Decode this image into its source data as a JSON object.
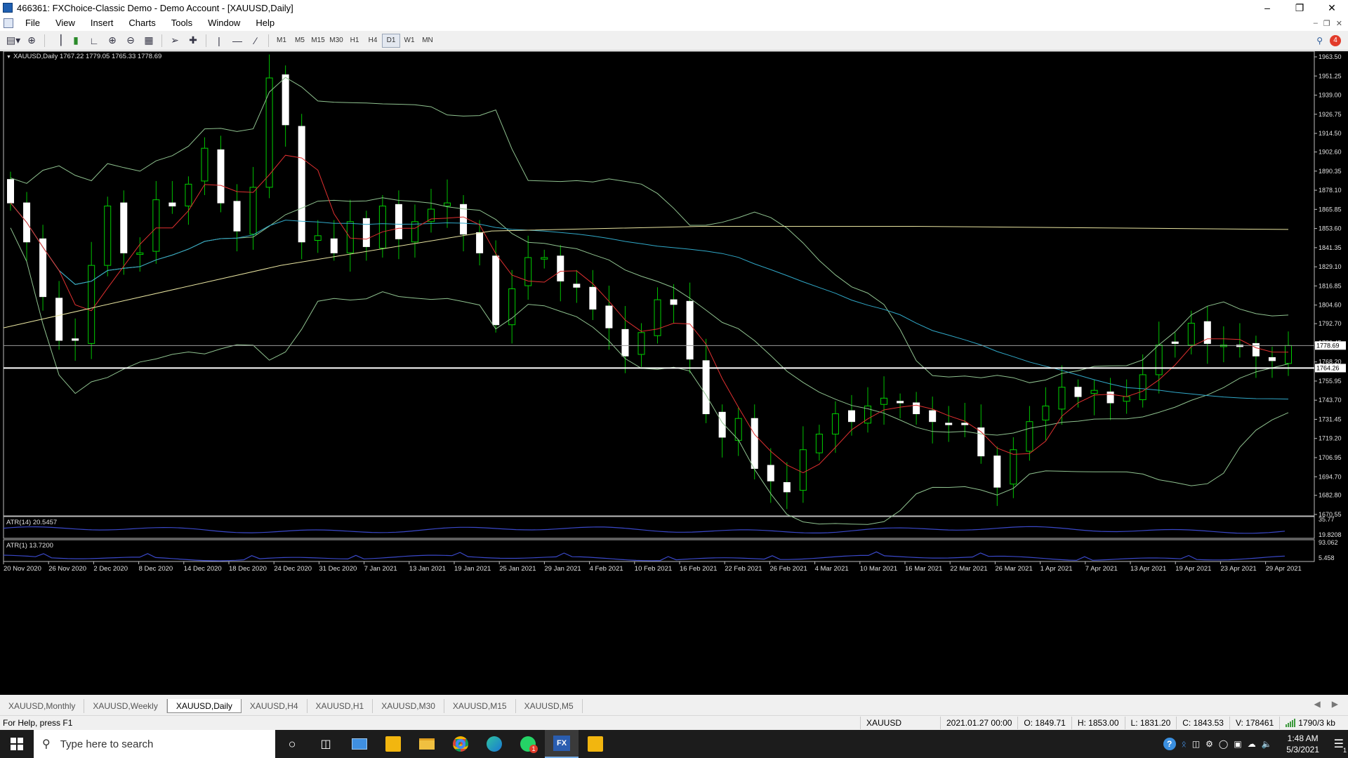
{
  "window": {
    "title": "466361: FXChoice-Classic Demo - Demo Account - [XAUUSD,Daily]",
    "minimize_icon": "minimize-icon",
    "restore_icon": "restore-icon",
    "close_icon": "close-icon"
  },
  "menu": {
    "items": [
      "File",
      "View",
      "Insert",
      "Charts",
      "Tools",
      "Window",
      "Help"
    ]
  },
  "toolbar": {
    "icons": [
      "new-chart-icon",
      "profiles-icon",
      "bar-chart-icon",
      "candlestick-icon",
      "line-chart-icon",
      "zoom-in-icon",
      "zoom-out-icon",
      "tile-windows-icon",
      "cursor-icon",
      "crosshair-icon",
      "vertical-line-icon",
      "horizontal-line-icon",
      "trendline-icon"
    ],
    "timeframes": [
      "M1",
      "M5",
      "M15",
      "M30",
      "H1",
      "H4",
      "D1",
      "W1",
      "MN"
    ],
    "active_timeframe": "D1",
    "notification_count": "4"
  },
  "chart": {
    "header": "XAUUSD,Daily  1767.22 1779.05 1765.33 1778.69",
    "price_ticks": [
      "1963.50",
      "1951.25",
      "1939.00",
      "1926.75",
      "1914.50",
      "1902.60",
      "1890.35",
      "1878.10",
      "1865.85",
      "1853.60",
      "1841.35",
      "1829.10",
      "1816.85",
      "1804.60",
      "1792.70",
      "1780.45",
      "1768.20",
      "1755.95",
      "1743.70",
      "1731.45",
      "1719.20",
      "1706.95",
      "1694.70",
      "1682.80",
      "1670.55"
    ],
    "current_price_label": "1778.69",
    "horizontal_line_label": "1764.26",
    "date_ticks": [
      "20 Nov 2020",
      "26 Nov 2020",
      "2 Dec 2020",
      "8 Dec 2020",
      "14 Dec 2020",
      "18 Dec 2020",
      "24 Dec 2020",
      "31 Dec 2020",
      "7 Jan 2021",
      "13 Jan 2021",
      "19 Jan 2021",
      "25 Jan 2021",
      "29 Jan 2021",
      "4 Feb 2021",
      "10 Feb 2021",
      "16 Feb 2021",
      "22 Feb 2021",
      "26 Feb 2021",
      "4 Mar 2021",
      "10 Mar 2021",
      "16 Mar 2021",
      "22 Mar 2021",
      "26 Mar 2021",
      "1 Apr 2021",
      "7 Apr 2021",
      "13 Apr 2021",
      "19 Apr 2021",
      "23 Apr 2021",
      "29 Apr 2021"
    ],
    "atr14_label": "ATR(14) 20.5457",
    "atr14_ticks": [
      "35.77",
      "19.8208"
    ],
    "atr1_label": "ATR(1) 13.7200",
    "atr1_ticks": [
      "93.062",
      "5.458"
    ],
    "colors": {
      "background": "#000000",
      "bull": "#00d000",
      "bear": "#ffffff",
      "bands": "#8fc28f",
      "ma_fast": "#e03030",
      "ma_slow": "#30a8c8",
      "ma_long": "#e8e4a0",
      "atr": "#3a48c8"
    }
  },
  "chart_data": {
    "type": "candlestick",
    "symbol": "XAUUSD",
    "timeframe": "Daily",
    "ylim": [
      1670.55,
      1963.5
    ],
    "x": [
      "20 Nov 2020",
      "26 Nov 2020",
      "2 Dec 2020",
      "8 Dec 2020",
      "14 Dec 2020",
      "18 Dec 2020",
      "24 Dec 2020",
      "31 Dec 2020",
      "7 Jan 2021",
      "13 Jan 2021",
      "19 Jan 2021",
      "25 Jan 2021",
      "29 Jan 2021",
      "4 Feb 2021",
      "10 Feb 2021",
      "16 Feb 2021",
      "22 Feb 2021",
      "26 Feb 2021",
      "4 Mar 2021",
      "10 Mar 2021",
      "16 Mar 2021",
      "22 Mar 2021",
      "26 Mar 2021",
      "1 Apr 2021",
      "7 Apr 2021",
      "13 Apr 2021",
      "19 Apr 2021",
      "23 Apr 2021",
      "29 Apr 2021"
    ],
    "close": [
      1870,
      1845,
      1810,
      1782,
      1782,
      1830,
      1868,
      1838,
      1838,
      1872,
      1868,
      1882,
      1905,
      1870,
      1852,
      1880,
      1950,
      1920,
      1845,
      1849,
      1838,
      1858,
      1842,
      1868,
      1847,
      1858,
      1866,
      1870,
      1850,
      1838,
      1792,
      1815,
      1835,
      1835,
      1820,
      1816,
      1802,
      1790,
      1772,
      1787,
      1808,
      1805,
      1770,
      1735,
      1720,
      1732,
      1700,
      1692,
      1685,
      1712,
      1722,
      1735,
      1730,
      1740,
      1745,
      1742,
      1735,
      1730,
      1728,
      1728,
      1708,
      1688,
      1712,
      1730,
      1740,
      1752,
      1746,
      1750,
      1742,
      1746,
      1760,
      1779,
      1780,
      1793,
      1780,
      1779,
      1778,
      1772,
      1769,
      1778.69
    ],
    "last_ohlc": {
      "open": 1767.22,
      "high": 1779.05,
      "low": 1765.33,
      "close": 1778.69
    },
    "horizontal_line": 1764.26,
    "atr14_last": 20.5457,
    "atr1_last": 13.72
  },
  "tabs": {
    "items": [
      "XAUUSD,Monthly",
      "XAUUSD,Weekly",
      "XAUUSD,Daily",
      "XAUUSD,H4",
      "XAUUSD,H1",
      "XAUUSD,M30",
      "XAUUSD,M15",
      "XAUUSD,M5"
    ],
    "active": "XAUUSD,Daily"
  },
  "status": {
    "help": "For Help, press F1",
    "symbol": "XAUUSD",
    "datetime": "2021.01.27 00:00",
    "open": "O: 1849.71",
    "high": "H: 1853.00",
    "low": "L: 1831.20",
    "close": "C: 1843.53",
    "volume": "V: 178461",
    "connection": "1790/3 kb"
  },
  "taskbar": {
    "search_placeholder": "Type here to search",
    "apps": [
      "task-view-icon",
      "multitasking-icon",
      "remote-desktop-icon",
      "app-yellow-icon",
      "file-explorer-icon",
      "chrome-icon",
      "edge-icon",
      "whatsapp-icon",
      "fxchoice-icon",
      "app-yellow-2-icon"
    ],
    "whatsapp_badge": "1",
    "fx_icon_label": "FX",
    "time": "1:48 AM",
    "date": "5/3/2021",
    "notification_count": "1"
  }
}
